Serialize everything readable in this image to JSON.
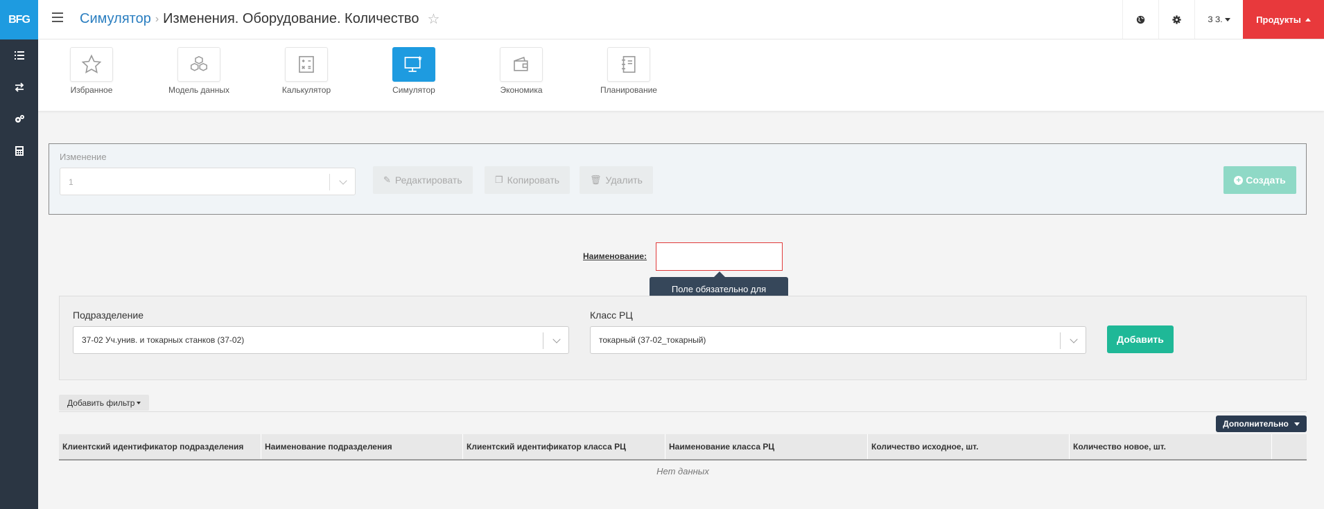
{
  "app": {
    "logo_text": "BFG"
  },
  "sidebar": {
    "items": [
      {
        "icon": "list-icon"
      },
      {
        "icon": "transfer-icon"
      },
      {
        "icon": "cogs-icon"
      },
      {
        "icon": "calculator-icon"
      }
    ]
  },
  "header": {
    "breadcrumb_link": "Симулятор",
    "breadcrumb_sep": "›",
    "title": "Изменения. Оборудование. Количество",
    "star": "☆",
    "user": "З З.",
    "products": "Продукты"
  },
  "modules": [
    {
      "label": "Избранное",
      "icon": "star-icon"
    },
    {
      "label": "Модель данных",
      "icon": "cubes-icon"
    },
    {
      "label": "Калькулятор",
      "icon": "calculator-icon"
    },
    {
      "label": "Симулятор",
      "icon": "monitor-icon",
      "active": true
    },
    {
      "label": "Экономика",
      "icon": "wallet-icon"
    },
    {
      "label": "Планирование",
      "icon": "notebook-icon"
    }
  ],
  "change": {
    "label": "Изменение",
    "value": "1",
    "edit": "Редактировать",
    "copy": "Копировать",
    "delete": "Удалить",
    "create": "Создать"
  },
  "name_field": {
    "label": "Наименование:",
    "value": "",
    "tooltip": "Поле обязательно для заполнения"
  },
  "filters": {
    "division_label": "Подразделение",
    "division_value": "37-02 Уч.унив. и токарных станков (37-02)",
    "class_label": "Класс РЦ",
    "class_value": "токарный (37-02_токарный)",
    "add_button": "Добавить"
  },
  "table": {
    "add_filter": "Добавить фильтр",
    "extra": "Дополнительно",
    "columns": [
      "Клиентский идентификатор подразделения",
      "Наименование подразделения",
      "Клиентский идентификатор класса РЦ",
      "Наименование класса РЦ",
      "Количество исходное, шт.",
      "Количество новое, шт."
    ],
    "empty": "Нет данных"
  },
  "colors": {
    "sidebar": "#2b3643",
    "accent": "#1e9be0",
    "products": "#e8393c",
    "success": "#1fb897",
    "error_border": "#e03a3a"
  }
}
